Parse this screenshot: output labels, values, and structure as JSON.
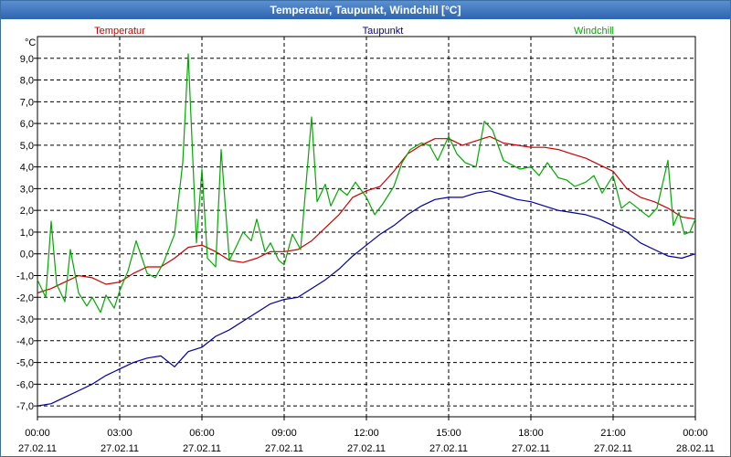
{
  "window": {
    "title": "Temperatur, Taupunkt, Windchill [°C]"
  },
  "chart_data": {
    "type": "line",
    "title": "Temperatur, Taupunkt, Windchill [°C]",
    "ylabel": "°C",
    "xlabel": "",
    "ylim": [
      -7.5,
      10
    ],
    "yticks": [
      -7.0,
      -6.0,
      -5.0,
      -4.0,
      -3.0,
      -2.0,
      -1.0,
      0.0,
      1.0,
      2.0,
      3.0,
      4.0,
      5.0,
      6.0,
      7.0,
      8.0,
      9.0
    ],
    "ytick_labels": [
      "-7,0",
      "-6,0",
      "-5,0",
      "-4,0",
      "-3,0",
      "-2,0",
      "-1,0",
      "0,0",
      "1,0",
      "2,0",
      "3,0",
      "4,0",
      "5,0",
      "6,0",
      "7,0",
      "8,0",
      "9,0"
    ],
    "xlim": [
      0,
      24
    ],
    "xticks": [
      {
        "hour": 0,
        "time": "00:00",
        "date": "27.02.11"
      },
      {
        "hour": 3,
        "time": "03:00",
        "date": "27.02.11"
      },
      {
        "hour": 6,
        "time": "06:00",
        "date": "27.02.11"
      },
      {
        "hour": 9,
        "time": "09:00",
        "date": "27.02.11"
      },
      {
        "hour": 12,
        "time": "12:00",
        "date": "27.02.11"
      },
      {
        "hour": 15,
        "time": "15:00",
        "date": "27.02.11"
      },
      {
        "hour": 18,
        "time": "18:00",
        "date": "27.02.11"
      },
      {
        "hour": 21,
        "time": "21:00",
        "date": "27.02.11"
      },
      {
        "hour": 24,
        "time": "00:00",
        "date": "28.02.11"
      }
    ],
    "grid": true,
    "series": [
      {
        "name": "Temperatur",
        "color": "#cc0000",
        "x": [
          0,
          0.5,
          1,
          1.5,
          2,
          2.5,
          3,
          3.5,
          4,
          4.5,
          5,
          5.5,
          6,
          6.5,
          7,
          7.5,
          8,
          8.5,
          9,
          9.5,
          10,
          10.5,
          11,
          11.5,
          12,
          12.5,
          13,
          13.5,
          14,
          14.5,
          15,
          15.5,
          16,
          16.5,
          17,
          17.5,
          18,
          18.5,
          19,
          19.5,
          20,
          20.5,
          21,
          21.5,
          22,
          22.5,
          23,
          23.5,
          24
        ],
        "values": [
          -1.8,
          -1.6,
          -1.3,
          -1.0,
          -1.1,
          -1.4,
          -1.3,
          -0.9,
          -0.6,
          -0.6,
          -0.2,
          0.3,
          0.4,
          0.1,
          -0.3,
          -0.4,
          -0.2,
          0.1,
          0.1,
          0.2,
          0.6,
          1.2,
          1.8,
          2.6,
          2.9,
          3.1,
          3.8,
          4.6,
          5.0,
          5.3,
          5.3,
          5.0,
          5.2,
          5.4,
          5.1,
          5.0,
          4.9,
          4.9,
          4.8,
          4.6,
          4.4,
          4.1,
          3.8,
          3.0,
          2.6,
          2.4,
          2.1,
          1.7,
          1.6
        ]
      },
      {
        "name": "Taupunkt",
        "color": "#00009c",
        "x": [
          0,
          0.5,
          1,
          1.5,
          2,
          2.5,
          3,
          3.5,
          4,
          4.5,
          5,
          5.5,
          6,
          6.5,
          7,
          7.5,
          8,
          8.5,
          9,
          9.5,
          10,
          10.5,
          11,
          11.5,
          12,
          12.5,
          13,
          13.5,
          14,
          14.5,
          15,
          15.5,
          16,
          16.5,
          17,
          17.5,
          18,
          18.5,
          19,
          19.5,
          20,
          20.5,
          21,
          21.5,
          22,
          22.5,
          23,
          23.5,
          24
        ],
        "values": [
          -7.0,
          -6.9,
          -6.6,
          -6.3,
          -6.0,
          -5.6,
          -5.3,
          -5.0,
          -4.8,
          -4.7,
          -5.2,
          -4.5,
          -4.3,
          -3.8,
          -3.5,
          -3.1,
          -2.7,
          -2.3,
          -2.1,
          -2.0,
          -1.6,
          -1.2,
          -0.7,
          -0.1,
          0.4,
          0.9,
          1.3,
          1.8,
          2.2,
          2.5,
          2.6,
          2.6,
          2.8,
          2.9,
          2.7,
          2.5,
          2.4,
          2.2,
          2.0,
          1.9,
          1.8,
          1.6,
          1.3,
          1.0,
          0.5,
          0.2,
          -0.1,
          -0.2,
          0.0
        ]
      },
      {
        "name": "Windchill",
        "color": "#00aa00",
        "x": [
          0,
          0.3,
          0.5,
          0.7,
          1,
          1.2,
          1.5,
          1.8,
          2,
          2.3,
          2.5,
          2.8,
          3,
          3.3,
          3.6,
          4,
          4.3,
          4.6,
          5,
          5.3,
          5.5,
          5.8,
          6,
          6.2,
          6.5,
          6.7,
          7,
          7.2,
          7.5,
          7.8,
          8,
          8.3,
          8.5,
          8.8,
          9,
          9.3,
          9.6,
          10,
          10.2,
          10.5,
          10.7,
          11,
          11.3,
          11.6,
          12,
          12.3,
          12.6,
          13,
          13.3,
          13.6,
          14,
          14.3,
          14.6,
          15,
          15.3,
          15.6,
          16,
          16.3,
          16.6,
          17,
          17.3,
          17.6,
          18,
          18.3,
          18.6,
          19,
          19.3,
          19.6,
          20,
          20.3,
          20.6,
          21,
          21.3,
          21.6,
          22,
          22.3,
          22.6,
          23,
          23.2,
          23.4,
          23.6,
          23.8,
          24
        ],
        "values": [
          -1.2,
          -2.0,
          1.5,
          -1.4,
          -2.2,
          0.2,
          -1.8,
          -2.4,
          -2.0,
          -2.7,
          -1.9,
          -2.5,
          -1.7,
          -0.8,
          0.6,
          -0.9,
          -1.1,
          -0.4,
          0.9,
          4.2,
          9.2,
          0.5,
          3.9,
          -0.2,
          -0.6,
          4.8,
          -0.3,
          0.2,
          1.0,
          0.6,
          1.6,
          0.1,
          0.5,
          -0.3,
          -0.5,
          0.9,
          0.2,
          6.3,
          2.4,
          3.2,
          2.2,
          3.0,
          2.7,
          3.3,
          2.6,
          1.8,
          2.3,
          3.1,
          4.2,
          4.8,
          5.1,
          5.0,
          4.3,
          5.4,
          4.6,
          4.2,
          4.0,
          6.1,
          5.7,
          4.3,
          4.1,
          3.9,
          4.0,
          3.6,
          4.2,
          3.5,
          3.4,
          3.1,
          3.3,
          3.6,
          2.8,
          3.6,
          2.1,
          2.4,
          2.0,
          1.7,
          2.1,
          4.3,
          1.3,
          1.9,
          0.9,
          1.0,
          1.6
        ]
      }
    ]
  }
}
